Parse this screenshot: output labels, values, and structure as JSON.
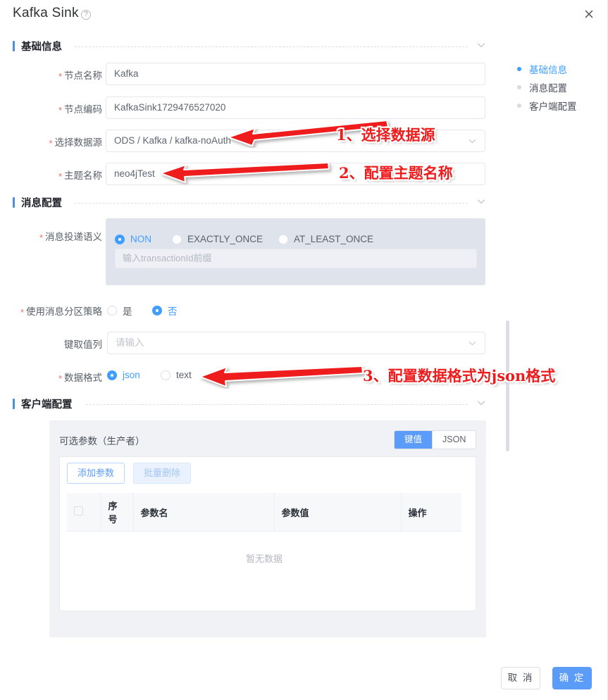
{
  "dialog": {
    "title": "Kafka Sink",
    "help_icon": "question-circle-icon",
    "close_icon": "close-icon"
  },
  "sections": [
    {
      "id": "basic",
      "title": "基础信息"
    },
    {
      "id": "msg",
      "title": "消息配置"
    },
    {
      "id": "client",
      "title": "客户端配置"
    }
  ],
  "basic_form": {
    "node_name": {
      "label": "节点名称",
      "value": "Kafka"
    },
    "node_code": {
      "label": "节点编码",
      "value": "KafkaSink1729476527020"
    },
    "datasource": {
      "label": "选择数据源",
      "value": "ODS / Kafka / kafka-noAuth"
    },
    "topic": {
      "label": "主题名称",
      "value": "neo4jTest"
    }
  },
  "msg_form": {
    "delivery": {
      "label": "消息投递语义",
      "options": [
        "NON",
        "EXACTLY_ONCE",
        "AT_LEAST_ONCE"
      ],
      "selected": "NON",
      "transaction_placeholder": "输入transactionId前缀",
      "transaction_value": ""
    },
    "partition": {
      "label": "使用消息分区策略",
      "options": [
        "是",
        "否"
      ],
      "selected": "否"
    },
    "key_column": {
      "label": "键取值列",
      "placeholder": "请输入",
      "value": ""
    },
    "data_format": {
      "label": "数据格式",
      "options": [
        "json",
        "text"
      ],
      "selected": "json"
    }
  },
  "client_config": {
    "panel_title": "可选参数（生产者）",
    "view_modes": [
      "键值",
      "JSON"
    ],
    "active_mode": "键值",
    "add_button": "添加参数",
    "bulk_delete_button": "批量删除",
    "table": {
      "columns": [
        "",
        "序号",
        "参数名",
        "参数值",
        "操作"
      ],
      "rows": [],
      "empty_text": "暂无数据"
    }
  },
  "right_nav": {
    "items": [
      {
        "label": "基础信息",
        "active": true
      },
      {
        "label": "消息配置",
        "active": false
      },
      {
        "label": "客户端配置",
        "active": false
      }
    ]
  },
  "footer": {
    "cancel": "取 消",
    "confirm": "确 定"
  },
  "annotations": [
    {
      "id": 1,
      "text": "1、选择数据源"
    },
    {
      "id": 2,
      "text": "2、配置主题名称"
    },
    {
      "id": 3,
      "text": "3、配置数据格式为json格式"
    }
  ],
  "colors": {
    "accent": "#409eff",
    "button_blue": "#5a9cf8",
    "required_star": "#f56c6c",
    "annotation_red": "#ee1c1c",
    "panel_gray": "#dfe3ec",
    "card_gray": "#f0f2f5"
  }
}
